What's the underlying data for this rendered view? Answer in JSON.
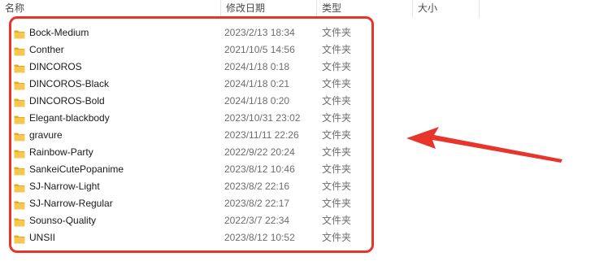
{
  "header": {
    "name_label": "名称",
    "date_label": "修改日期",
    "type_label": "类型",
    "size_label": "大小",
    "sort_indicator": "^"
  },
  "files": [
    {
      "name": "Bock-Medium",
      "date": "2023/2/13 18:34",
      "type": "文件夹"
    },
    {
      "name": "Conther",
      "date": "2021/10/5 14:56",
      "type": "文件夹"
    },
    {
      "name": "DINCOROS",
      "date": "2024/1/18 0:18",
      "type": "文件夹"
    },
    {
      "name": "DINCOROS-Black",
      "date": "2024/1/18 0:21",
      "type": "文件夹"
    },
    {
      "name": "DINCOROS-Bold",
      "date": "2024/1/18 0:20",
      "type": "文件夹"
    },
    {
      "name": "Elegant-blackbody",
      "date": "2023/10/31 23:02",
      "type": "文件夹"
    },
    {
      "name": "gravure",
      "date": "2023/11/11 22:26",
      "type": "文件夹"
    },
    {
      "name": "Rainbow-Party",
      "date": "2022/9/22 20:24",
      "type": "文件夹"
    },
    {
      "name": "SankeiCutePopanime",
      "date": "2023/8/12 10:46",
      "type": "文件夹"
    },
    {
      "name": "SJ-Narrow-Light",
      "date": "2023/8/2 22:16",
      "type": "文件夹"
    },
    {
      "name": "SJ-Narrow-Regular",
      "date": "2023/8/2 22:17",
      "type": "文件夹"
    },
    {
      "name": "Sounso-Quality",
      "date": "2022/3/7 22:34",
      "type": "文件夹"
    },
    {
      "name": "UNSII",
      "date": "2023/8/12 10:52",
      "type": "文件夹"
    }
  ],
  "colors": {
    "folder": "#f7c850",
    "folder_dark": "#e8a920",
    "annotation": "#e8352c"
  },
  "icons": {
    "folder": "folder-icon",
    "arrow": "annotation-arrow"
  }
}
